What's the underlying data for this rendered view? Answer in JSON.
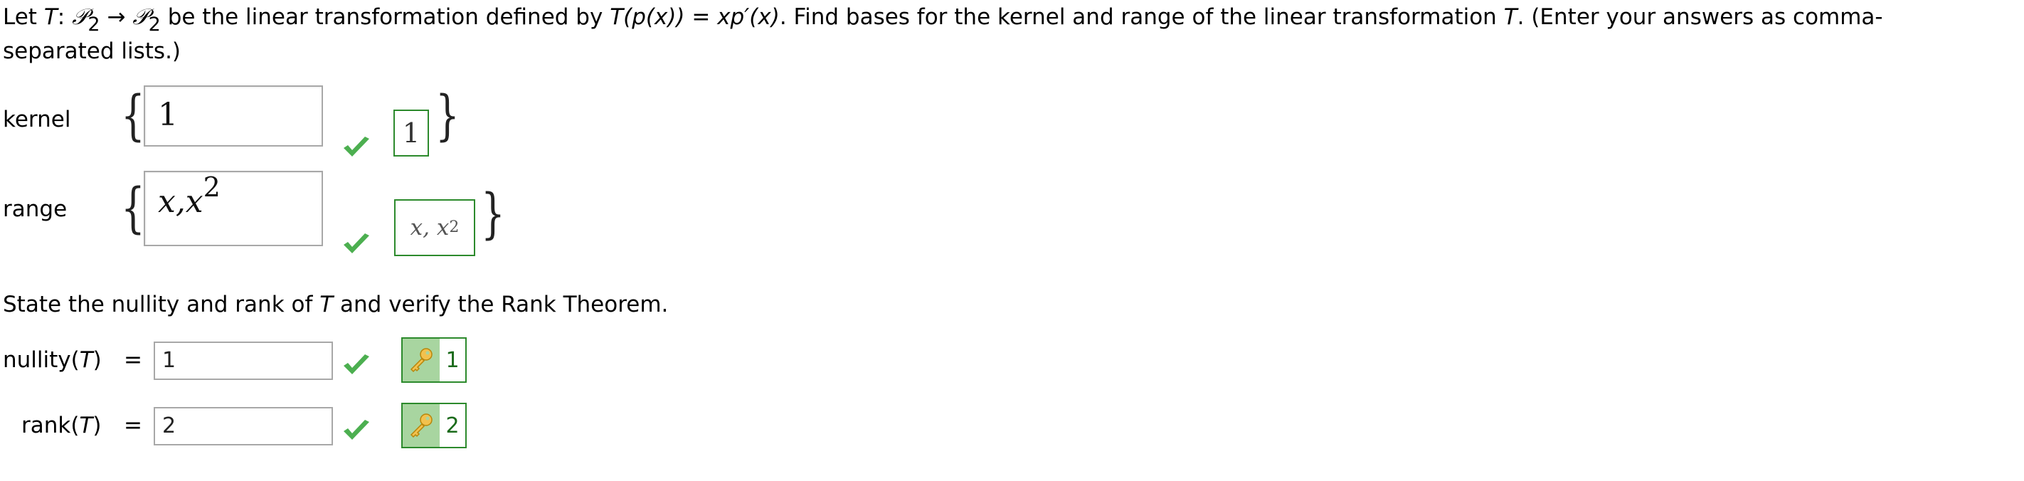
{
  "question": {
    "line1_let": "Let ",
    "line1_T": "T",
    "line1_colon": ": ",
    "space_P": "𝒫",
    "space_sub": "2",
    "arrow": " → ",
    "line1_rest_a": " be the linear transformation defined by ",
    "line1_def": "T(p(x)) = xp′(x)",
    "line1_rest_b": ". Find bases for the kernel and range of the linear transformation ",
    "line1_rest_c": ". (Enter your answers as comma-",
    "line2": "separated lists.)"
  },
  "kernel": {
    "label": "kernel",
    "input_value": "1",
    "answer": "1"
  },
  "range": {
    "label": "range",
    "input_base": "x,x",
    "input_exp": "2",
    "answer_base": "x, x",
    "answer_exp": "2"
  },
  "rank_question": {
    "text_a": "State the nullity and rank of ",
    "T": "T",
    "text_b": " and verify the Rank Theorem."
  },
  "nullity": {
    "label_fn": "nullity(",
    "label_T": "T",
    "label_close": ")",
    "equals": "=",
    "input_value": "1",
    "answer": "1"
  },
  "rank": {
    "label_fn": "rank(",
    "label_T": "T",
    "label_close": ")",
    "equals": "=",
    "input_value": "2",
    "answer": "2"
  },
  "colors": {
    "correct_green": "#2c8a2c",
    "check_green": "#4caf50",
    "key_bg": "#a8d5a0"
  },
  "icons": [
    "checkmark-icon",
    "key-icon"
  ]
}
